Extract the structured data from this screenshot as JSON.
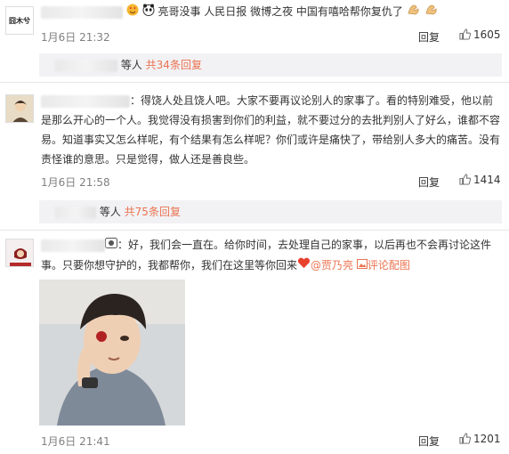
{
  "c1": {
    "text": "亮哥没事 人民日报 微博之夜 中国有嘻哈帮你复仇了",
    "time": "1月6日 21:32",
    "reply": "回复",
    "likes": "1605",
    "avatar_text": "囧木兮",
    "sub_prefix": "等人",
    "sub_link": "共34条回复"
  },
  "c2": {
    "line1": "：得饶人处且饶人吧。大家不要再议论别人的家事了。看的特别难受，他以前",
    "line2": "是那么开心的一个人。我觉得没有损害到你们的利益，就不要过分的去批判别人了好么，谁都不容",
    "line3": "易。知道事实又怎么样呢，有个结果有怎么样呢？你们或许是痛快了，带给别人多大的痛苦。没有",
    "line4": "责怪谁的意思。只是觉得，做人还是善良些。",
    "time": "1月6日 21:58",
    "reply": "回复",
    "likes": "1414",
    "sub_prefix": "等人",
    "sub_link": "共75条回复"
  },
  "c3": {
    "line1": "：好，我们会一直在。给你时间，去处理自己的家事，以后再也不会再讨论这件",
    "line2": "事。只要你想守护的，我都帮你，我们在这里等你回来",
    "mention": "@贾乃亮",
    "pic_link": "评论配图",
    "time": "1月6日 21:41",
    "reply": "回复",
    "likes": "1201"
  },
  "colors": {
    "accent": "#eb7350",
    "meta": "#808080",
    "subbar_bg": "#f2f2f5"
  }
}
